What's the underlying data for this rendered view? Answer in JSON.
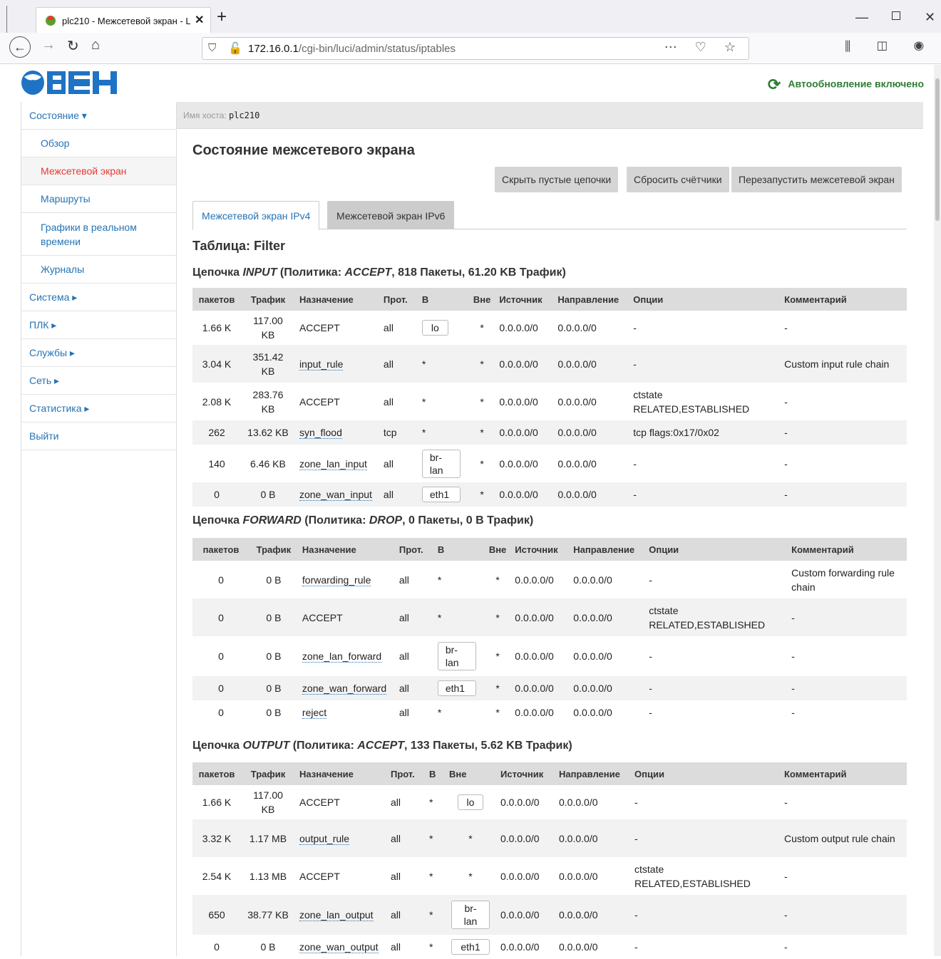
{
  "browser": {
    "tab_title": "plc210 - Межсетевой экран - L",
    "url_host": "172.16.0.1",
    "url_path": "/cgi-bin/luci/admin/status/iptables"
  },
  "header": {
    "logo_text": "ОВЕН",
    "autorefresh": "Автообновление включено"
  },
  "sidebar": {
    "items": [
      {
        "label": "Состояние ▾",
        "type": "top"
      },
      {
        "label": "Обзор",
        "type": "sub"
      },
      {
        "label": "Межсетевой экран",
        "type": "sub",
        "active": true
      },
      {
        "label": "Маршруты",
        "type": "sub"
      },
      {
        "label": "Графики в реальном времени",
        "type": "sub-tall"
      },
      {
        "label": "Журналы",
        "type": "sub"
      },
      {
        "label": "Система ▸",
        "type": "top"
      },
      {
        "label": "ПЛК ▸",
        "type": "top"
      },
      {
        "label": "Службы ▸",
        "type": "top"
      },
      {
        "label": "Сеть ▸",
        "type": "top"
      },
      {
        "label": "Статистика ▸",
        "type": "top"
      },
      {
        "label": "Выйти",
        "type": "top"
      }
    ]
  },
  "host": {
    "label": "Имя хоста:",
    "value": "plc210"
  },
  "main": {
    "title": "Состояние межсетевого экрана",
    "buttons": {
      "hide_empty": "Скрыть пустые цепочки",
      "reset_counters": "Сбросить счётчики",
      "restart": "Перезапустить межсетевой экран"
    },
    "tabs": {
      "ipv4": "Межсетевой экран IPv4",
      "ipv6": "Межсетевой экран IPv6"
    },
    "table_title": "Таблица: Filter"
  },
  "columns": [
    "пакетов",
    "Трафик",
    "Назначение",
    "Прот.",
    "В",
    "Вне",
    "Источник",
    "Направление",
    "Опции",
    "Комментарий"
  ],
  "chains": [
    {
      "title_prefix": "Цепочка ",
      "name": "INPUT",
      "policy_label": " (Политика: ",
      "policy": "ACCEPT",
      "stats": ", 818 Пакеты, 61.20 KB Трафик)",
      "rows": [
        {
          "pkts": "1.66 K",
          "traffic": "117.00 KB",
          "target": "ACCEPT",
          "link": false,
          "prot": "all",
          "in": "lo",
          "out": "*",
          "src": "0.0.0.0/0",
          "dst": "0.0.0.0/0",
          "opts": "-",
          "comment": "-"
        },
        {
          "pkts": "3.04 K",
          "traffic": "351.42 KB",
          "target": "input_rule",
          "link": true,
          "prot": "all",
          "in": "*",
          "out": "*",
          "src": "0.0.0.0/0",
          "dst": "0.0.0.0/0",
          "opts": "-",
          "comment": "Custom input rule chain"
        },
        {
          "pkts": "2.08 K",
          "traffic": "283.76 KB",
          "target": "ACCEPT",
          "link": false,
          "prot": "all",
          "in": "*",
          "out": "*",
          "src": "0.0.0.0/0",
          "dst": "0.0.0.0/0",
          "opts": "ctstate RELATED,ESTABLISHED",
          "comment": "-"
        },
        {
          "pkts": "262",
          "traffic": "13.62 KB",
          "target": "syn_flood",
          "link": true,
          "prot": "tcp",
          "in": "*",
          "out": "*",
          "src": "0.0.0.0/0",
          "dst": "0.0.0.0/0",
          "opts": "tcp flags:0x17/0x02",
          "comment": "-"
        },
        {
          "pkts": "140",
          "traffic": "6.46 KB",
          "target": "zone_lan_input",
          "link": true,
          "prot": "all",
          "in": "br-lan",
          "out": "*",
          "src": "0.0.0.0/0",
          "dst": "0.0.0.0/0",
          "opts": "-",
          "comment": "-"
        },
        {
          "pkts": "0",
          "traffic": "0 B",
          "target": "zone_wan_input",
          "link": true,
          "prot": "all",
          "in": "eth1",
          "out": "*",
          "src": "0.0.0.0/0",
          "dst": "0.0.0.0/0",
          "opts": "-",
          "comment": "-"
        }
      ]
    },
    {
      "title_prefix": "Цепочка ",
      "name": "FORWARD",
      "policy_label": " (Политика: ",
      "policy": "DROP",
      "stats": ", 0 Пакеты, 0 B Трафик)",
      "rows": [
        {
          "pkts": "0",
          "traffic": "0 B",
          "target": "forwarding_rule",
          "link": true,
          "prot": "all",
          "in": "*",
          "out": "*",
          "src": "0.0.0.0/0",
          "dst": "0.0.0.0/0",
          "opts": "-",
          "comment": "Custom forwarding rule chain"
        },
        {
          "pkts": "0",
          "traffic": "0 B",
          "target": "ACCEPT",
          "link": false,
          "prot": "all",
          "in": "*",
          "out": "*",
          "src": "0.0.0.0/0",
          "dst": "0.0.0.0/0",
          "opts": "ctstate RELATED,ESTABLISHED",
          "comment": "-"
        },
        {
          "pkts": "0",
          "traffic": "0 B",
          "target": "zone_lan_forward",
          "link": true,
          "prot": "all",
          "in": "br-lan",
          "out": "*",
          "src": "0.0.0.0/0",
          "dst": "0.0.0.0/0",
          "opts": "-",
          "comment": "-"
        },
        {
          "pkts": "0",
          "traffic": "0 B",
          "target": "zone_wan_forward",
          "link": true,
          "prot": "all",
          "in": "eth1",
          "out": "*",
          "src": "0.0.0.0/0",
          "dst": "0.0.0.0/0",
          "opts": "-",
          "comment": "-"
        },
        {
          "pkts": "0",
          "traffic": "0 B",
          "target": "reject",
          "link": true,
          "prot": "all",
          "in": "*",
          "out": "*",
          "src": "0.0.0.0/0",
          "dst": "0.0.0.0/0",
          "opts": "-",
          "comment": "-"
        }
      ]
    },
    {
      "title_prefix": "Цепочка ",
      "name": "OUTPUT",
      "policy_label": " (Политика: ",
      "policy": "ACCEPT",
      "stats": ", 133 Пакеты, 5.62 KB Трафик)",
      "rows": [
        {
          "pkts": "1.66 K",
          "traffic": "117.00 KB",
          "target": "ACCEPT",
          "link": false,
          "prot": "all",
          "in": "*",
          "out": "lo",
          "src": "0.0.0.0/0",
          "dst": "0.0.0.0/0",
          "opts": "-",
          "comment": "-"
        },
        {
          "pkts": "3.32 K",
          "traffic": "1.17 MB",
          "target": "output_rule",
          "link": true,
          "prot": "all",
          "in": "*",
          "out": "*",
          "src": "0.0.0.0/0",
          "dst": "0.0.0.0/0",
          "opts": "-",
          "comment": "Custom output rule chain"
        },
        {
          "pkts": "2.54 K",
          "traffic": "1.13 MB",
          "target": "ACCEPT",
          "link": false,
          "prot": "all",
          "in": "*",
          "out": "*",
          "src": "0.0.0.0/0",
          "dst": "0.0.0.0/0",
          "opts": "ctstate RELATED,ESTABLISHED",
          "comment": "-"
        },
        {
          "pkts": "650",
          "traffic": "38.77 KB",
          "target": "zone_lan_output",
          "link": true,
          "prot": "all",
          "in": "*",
          "out": "br-lan",
          "src": "0.0.0.0/0",
          "dst": "0.0.0.0/0",
          "opts": "-",
          "comment": "-"
        },
        {
          "pkts": "0",
          "traffic": "0 B",
          "target": "zone_wan_output",
          "link": true,
          "prot": "all",
          "in": "*",
          "out": "eth1",
          "src": "0.0.0.0/0",
          "dst": "0.0.0.0/0",
          "opts": "-",
          "comment": "-"
        }
      ]
    }
  ],
  "colors": {
    "link": "#2573b6",
    "active": "#e53935",
    "refresh": "#2e7d32",
    "logo": "#1f73c4"
  }
}
